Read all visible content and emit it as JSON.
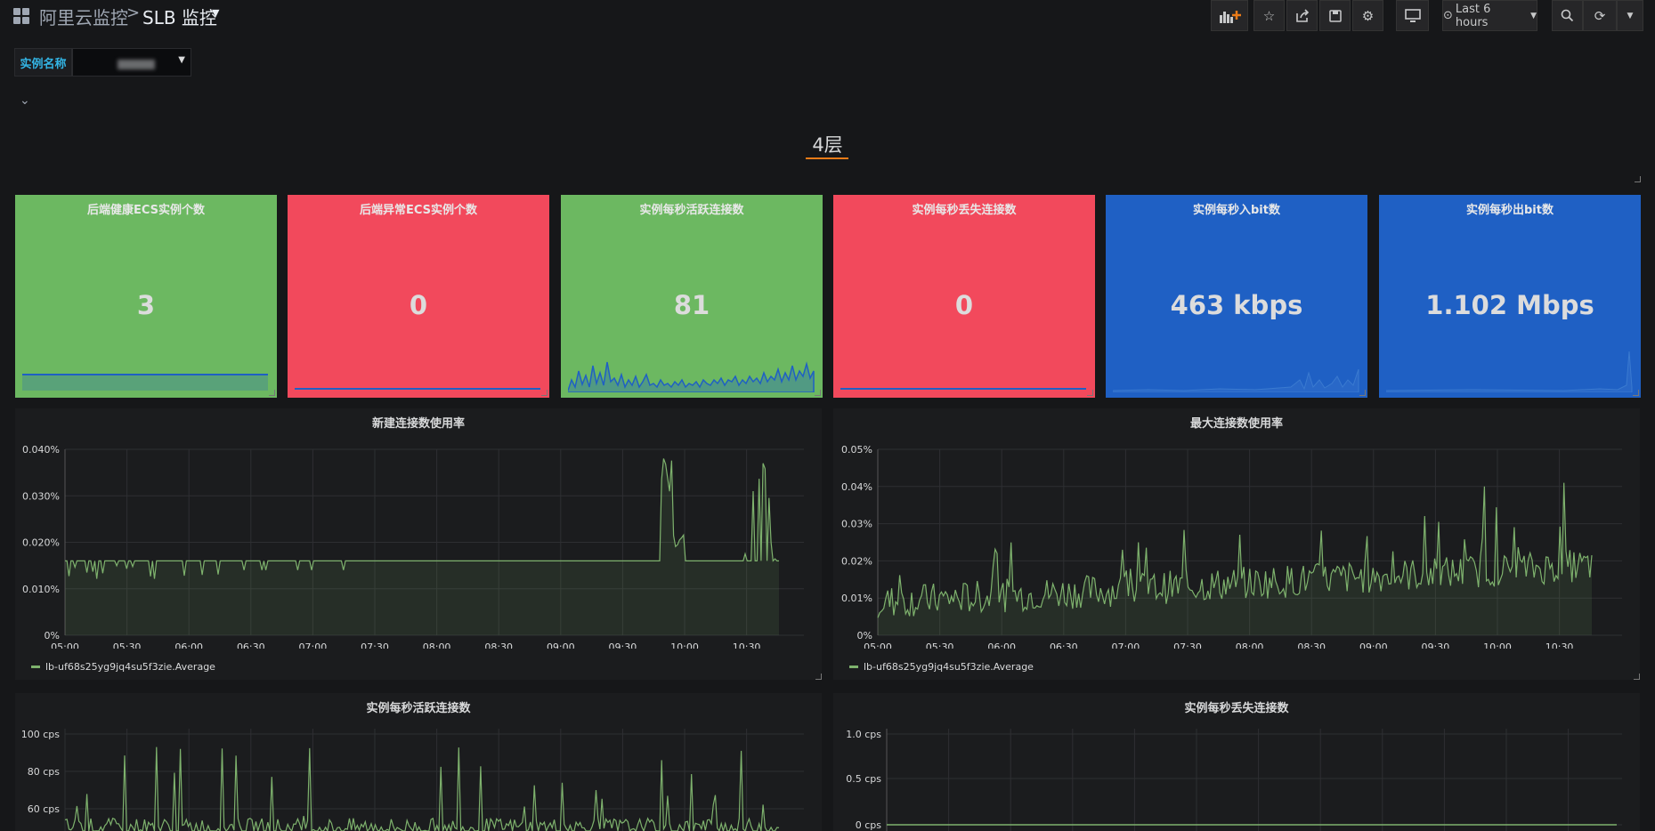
{
  "header": {
    "breadcrumb_parent": "阿里云监控",
    "breadcrumb_separator": ">",
    "title": "SLB 监控",
    "time_range": "Last 6 hours",
    "icons": [
      "add-panel-icon",
      "star-icon",
      "share-icon",
      "save-icon",
      "settings-icon",
      "tv-mode-icon",
      "zoom-out-icon",
      "refresh-icon",
      "refresh-interval-caret-icon"
    ]
  },
  "variables": {
    "instance_label": "实例名称"
  },
  "row": {
    "title": "4层"
  },
  "colors": {
    "green": "#6cb861",
    "red": "#f2495c",
    "blue": "#1f60c4",
    "line": "#7eb26d",
    "accent": "#eb7b18"
  },
  "stats": [
    {
      "title": "后端健康ECS实例个数",
      "value": "3",
      "color": "green"
    },
    {
      "title": "后端异常ECS实例个数",
      "value": "0",
      "color": "red"
    },
    {
      "title": "实例每秒活跃连接数",
      "value": "81",
      "color": "green"
    },
    {
      "title": "实例每秒丢失连接数",
      "value": "0",
      "color": "red"
    },
    {
      "title": "实例每秒入bit数",
      "value": "463 kbps",
      "color": "blue"
    },
    {
      "title": "实例每秒出bit数",
      "value": "1.102 Mbps",
      "color": "blue"
    }
  ],
  "graphs": [
    {
      "title": "新建连接数使用率",
      "legend": "lb-uf68s25yg9jq4su5f3zie.Average"
    },
    {
      "title": "最大连接数使用率",
      "legend": "lb-uf68s25yg9jq4su5f3zie.Average"
    },
    {
      "title": "实例每秒活跃连接数",
      "legend": ""
    },
    {
      "title": "实例每秒丢失连接数",
      "legend": ""
    }
  ],
  "chart_data": [
    {
      "type": "area",
      "title": "新建连接数使用率",
      "x": [
        "05:00",
        "05:30",
        "06:00",
        "06:30",
        "07:00",
        "07:30",
        "08:00",
        "08:30",
        "09:00",
        "09:30",
        "10:00",
        "10:30"
      ],
      "yticks": [
        "0%",
        "0.010%",
        "0.020%",
        "0.030%",
        "0.040%"
      ],
      "ylim": [
        0,
        0.04
      ],
      "series": [
        {
          "name": "lb-uf68s25yg9jq4su5f3zie.Average",
          "baseline": 0.016,
          "note_peaks": [
            0.038,
            0.037
          ]
        }
      ]
    },
    {
      "type": "area",
      "title": "最大连接数使用率",
      "x": [
        "05:00",
        "05:30",
        "06:00",
        "06:30",
        "07:00",
        "07:30",
        "08:00",
        "08:30",
        "09:00",
        "09:30",
        "10:00",
        "10:30"
      ],
      "yticks": [
        "0%",
        "0.01%",
        "0.02%",
        "0.03%",
        "0.04%",
        "0.05%"
      ],
      "ylim": [
        0,
        0.05
      ],
      "series": [
        {
          "name": "lb-uf68s25yg9jq4su5f3zie.Average"
        }
      ]
    },
    {
      "type": "line",
      "title": "实例每秒活跃连接数",
      "yticks": [
        "60 cps",
        "80 cps",
        "100 cps"
      ]
    },
    {
      "type": "line",
      "title": "实例每秒丢失连接数",
      "yticks": [
        "0 cps",
        "0.5 cps",
        "1.0 cps"
      ],
      "ylim": [
        0,
        1.0
      ]
    }
  ]
}
